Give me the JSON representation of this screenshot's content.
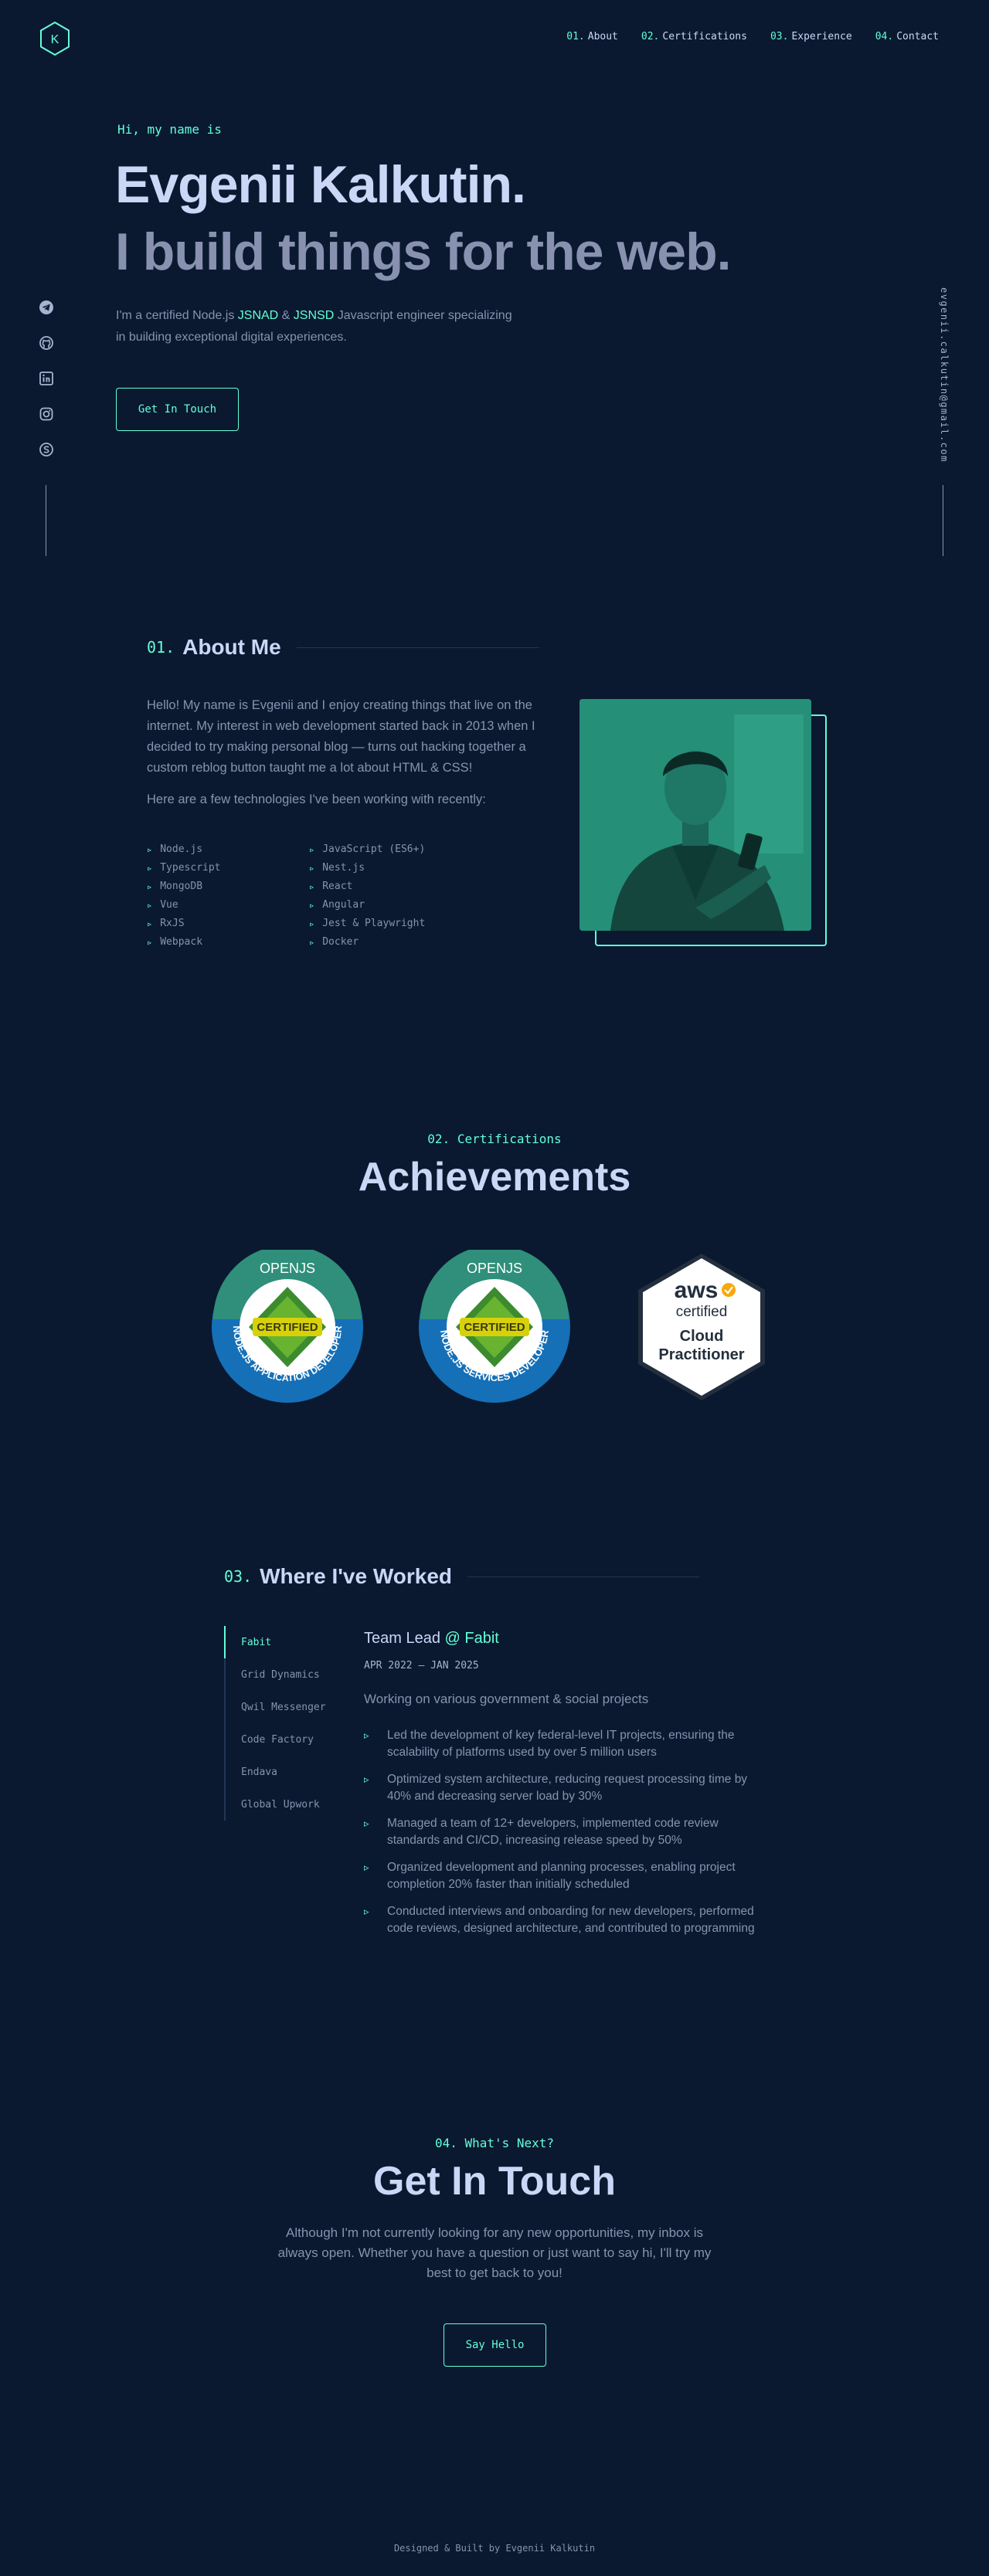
{
  "nav": {
    "logo_letter": "K",
    "links": [
      {
        "num": "01.",
        "label": "About"
      },
      {
        "num": "02.",
        "label": "Certifications"
      },
      {
        "num": "03.",
        "label": "Experience"
      },
      {
        "num": "04.",
        "label": "Contact"
      }
    ]
  },
  "social": {
    "icons": [
      "telegram-icon",
      "github-icon",
      "linkedin-icon",
      "instagram-icon",
      "skype-icon"
    ],
    "email": "evgenii.calkutin@gmail.com"
  },
  "hero": {
    "intro": "Hi, my name is",
    "name": "Evgenii Kalkutin.",
    "tagline": "I build things for the web.",
    "desc_1": "I'm a certified Node.js ",
    "desc_hl_1": "JSNAD",
    "desc_amp": " & ",
    "desc_hl_2": "JSNSD",
    "desc_2": " Javascript engineer specializing in building exceptional digital experiences.",
    "button": "Get In Touch"
  },
  "about": {
    "num": "01.",
    "title": "About Me",
    "para_1": "Hello! My name is Evgenii and I enjoy creating things that live on the internet. My interest in web development started back in 2013 when I decided to try making personal blog — turns out hacking together a custom reblog button taught me a lot about HTML & CSS!",
    "para_2": "Here are a few technologies I've been working with recently:",
    "tech": [
      "Node.js",
      "JavaScript (ES6+)",
      "Typescript",
      "Nest.js",
      "MongoDB",
      "React",
      "Vue",
      "Angular",
      "RxJS",
      "Jest & Playwright",
      "Webpack",
      "Docker"
    ]
  },
  "certs": {
    "overline": "02. Certifications",
    "title": "Achievements",
    "badges": [
      {
        "top": "OPENJS",
        "mid": "CERTIFIED",
        "ring": "NODE.JS APPLICATION DEVELOPER"
      },
      {
        "top": "OPENJS",
        "mid": "CERTIFIED",
        "ring": "NODE.JS SERVICES DEVELOPER"
      },
      {
        "top": "aws",
        "mid": "certified",
        "line1": "Cloud",
        "line2": "Practitioner"
      }
    ]
  },
  "experience": {
    "num": "03.",
    "title": "Where I've Worked",
    "tabs": [
      "Fabit",
      "Grid Dynamics",
      "Qwil Messenger",
      "Code Factory",
      "Endava",
      "Global Upwork"
    ],
    "job_title": "Team Lead",
    "job_company": "@ Fabit",
    "job_range": "APR 2022 — JAN 2025",
    "job_sub": "Working on various government & social projects",
    "points": [
      "Led the development of key federal-level IT projects, ensuring the scalability of platforms used by over 5 million users",
      "Optimized system architecture, reducing request processing time by 40% and decreasing server load by 30%",
      "Managed a team of 12+ developers, implemented code review standards and CI/CD, increasing release speed by 50%",
      "Organized development and planning processes, enabling project completion 20% faster than initially scheduled",
      "Conducted interviews and onboarding for new developers, performed code reviews, designed architecture, and contributed to programming"
    ]
  },
  "contact": {
    "overline": "04. What's Next?",
    "title": "Get In Touch",
    "text": "Although I'm not currently looking for any new opportunities, my inbox is always open. Whether you have a question or just want to say hi, I'll try my best to get back to you!",
    "button": "Say Hello"
  },
  "footer": "Designed & Built by Evgenii Kalkutin",
  "colors": {
    "bg": "#0a192f",
    "accent": "#64ffda",
    "heading": "#ccd6f6",
    "text": "#8892b0"
  }
}
